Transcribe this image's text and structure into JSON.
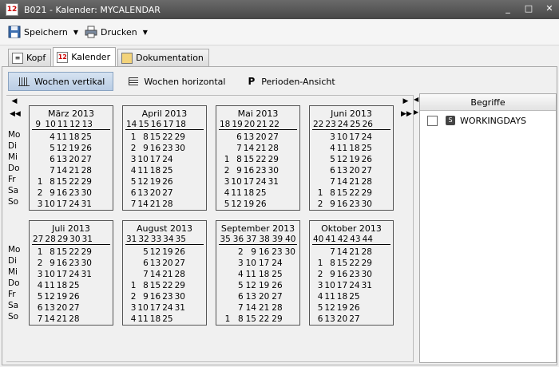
{
  "window": {
    "title": "B021 - Kalender: MYCALENDAR",
    "app_icon_text": "12"
  },
  "toolbar": {
    "save_label": "Speichern",
    "print_label": "Drucken"
  },
  "tabs": [
    {
      "label": "Kopf"
    },
    {
      "label": "Kalender",
      "active": true
    },
    {
      "label": "Dokumentation"
    }
  ],
  "views": [
    {
      "label": "Wochen vertikal",
      "active": true
    },
    {
      "label": "Wochen horizontal"
    },
    {
      "label": "Perioden-Ansicht",
      "icon_letter": "P"
    }
  ],
  "day_labels": [
    "Mo",
    "Di",
    "Mi",
    "Do",
    "Fr",
    "Sa",
    "So"
  ],
  "months": [
    {
      "title": "März 2013",
      "weeks": [
        "9",
        "10",
        "11",
        "12",
        "13"
      ],
      "rows": [
        [
          "",
          "4",
          "11",
          "18",
          "25"
        ],
        [
          "",
          "5",
          "12",
          "19",
          "26"
        ],
        [
          "",
          "6",
          "13",
          "20",
          "27"
        ],
        [
          "",
          "7",
          "14",
          "21",
          "28"
        ],
        [
          "1",
          "8",
          "15",
          "22",
          "29"
        ],
        [
          "2",
          "9",
          "16",
          "23",
          "30"
        ],
        [
          "3",
          "10",
          "17",
          "24",
          "31"
        ]
      ]
    },
    {
      "title": "April 2013",
      "weeks": [
        "14",
        "15",
        "16",
        "17",
        "18"
      ],
      "rows": [
        [
          "1",
          "8",
          "15",
          "22",
          "29"
        ],
        [
          "2",
          "9",
          "16",
          "23",
          "30"
        ],
        [
          "3",
          "10",
          "17",
          "24",
          ""
        ],
        [
          "4",
          "11",
          "18",
          "25",
          ""
        ],
        [
          "5",
          "12",
          "19",
          "26",
          ""
        ],
        [
          "6",
          "13",
          "20",
          "27",
          ""
        ],
        [
          "7",
          "14",
          "21",
          "28",
          ""
        ]
      ]
    },
    {
      "title": "Mai 2013",
      "weeks": [
        "18",
        "19",
        "20",
        "21",
        "22"
      ],
      "rows": [
        [
          "",
          "6",
          "13",
          "20",
          "27"
        ],
        [
          "",
          "7",
          "14",
          "21",
          "28"
        ],
        [
          "1",
          "8",
          "15",
          "22",
          "29"
        ],
        [
          "2",
          "9",
          "16",
          "23",
          "30"
        ],
        [
          "3",
          "10",
          "17",
          "24",
          "31"
        ],
        [
          "4",
          "11",
          "18",
          "25",
          ""
        ],
        [
          "5",
          "12",
          "19",
          "26",
          ""
        ]
      ]
    },
    {
      "title": "Juni 2013",
      "weeks": [
        "22",
        "23",
        "24",
        "25",
        "26"
      ],
      "rows": [
        [
          "",
          "3",
          "10",
          "17",
          "24"
        ],
        [
          "",
          "4",
          "11",
          "18",
          "25"
        ],
        [
          "",
          "5",
          "12",
          "19",
          "26"
        ],
        [
          "",
          "6",
          "13",
          "20",
          "27"
        ],
        [
          "",
          "7",
          "14",
          "21",
          "28"
        ],
        [
          "1",
          "8",
          "15",
          "22",
          "29"
        ],
        [
          "2",
          "9",
          "16",
          "23",
          "30"
        ]
      ]
    },
    {
      "title": "Juli 2013",
      "weeks": [
        "27",
        "28",
        "29",
        "30",
        "31"
      ],
      "rows": [
        [
          "1",
          "8",
          "15",
          "22",
          "29"
        ],
        [
          "2",
          "9",
          "16",
          "23",
          "30"
        ],
        [
          "3",
          "10",
          "17",
          "24",
          "31"
        ],
        [
          "4",
          "11",
          "18",
          "25",
          ""
        ],
        [
          "5",
          "12",
          "19",
          "26",
          ""
        ],
        [
          "6",
          "13",
          "20",
          "27",
          ""
        ],
        [
          "7",
          "14",
          "21",
          "28",
          ""
        ]
      ]
    },
    {
      "title": "August 2013",
      "weeks": [
        "31",
        "32",
        "33",
        "34",
        "35"
      ],
      "rows": [
        [
          "",
          "5",
          "12",
          "19",
          "26"
        ],
        [
          "",
          "6",
          "13",
          "20",
          "27"
        ],
        [
          "",
          "7",
          "14",
          "21",
          "28"
        ],
        [
          "1",
          "8",
          "15",
          "22",
          "29"
        ],
        [
          "2",
          "9",
          "16",
          "23",
          "30"
        ],
        [
          "3",
          "10",
          "17",
          "24",
          "31"
        ],
        [
          "4",
          "11",
          "18",
          "25",
          ""
        ]
      ]
    },
    {
      "title": "September 2013",
      "weeks": [
        "35",
        "36",
        "37",
        "38",
        "39",
        "40"
      ],
      "rows": [
        [
          "",
          "2",
          "9",
          "16",
          "23",
          "30"
        ],
        [
          "",
          "3",
          "10",
          "17",
          "24",
          ""
        ],
        [
          "",
          "4",
          "11",
          "18",
          "25",
          ""
        ],
        [
          "",
          "5",
          "12",
          "19",
          "26",
          ""
        ],
        [
          "",
          "6",
          "13",
          "20",
          "27",
          ""
        ],
        [
          "",
          "7",
          "14",
          "21",
          "28",
          ""
        ],
        [
          "1",
          "8",
          "15",
          "22",
          "29",
          ""
        ]
      ]
    },
    {
      "title": "Oktober 2013",
      "weeks": [
        "40",
        "41",
        "42",
        "43",
        "44"
      ],
      "rows": [
        [
          "",
          "7",
          "14",
          "21",
          "28"
        ],
        [
          "1",
          "8",
          "15",
          "22",
          "29"
        ],
        [
          "2",
          "9",
          "16",
          "23",
          "30"
        ],
        [
          "3",
          "10",
          "17",
          "24",
          "31"
        ],
        [
          "4",
          "11",
          "18",
          "25",
          ""
        ],
        [
          "5",
          "12",
          "19",
          "26",
          ""
        ],
        [
          "6",
          "13",
          "20",
          "27",
          ""
        ]
      ]
    }
  ],
  "right_panel": {
    "header": "Begriffe",
    "items": [
      {
        "label": "WORKINGDAYS",
        "checked": false,
        "icon_letter": "S"
      }
    ]
  }
}
